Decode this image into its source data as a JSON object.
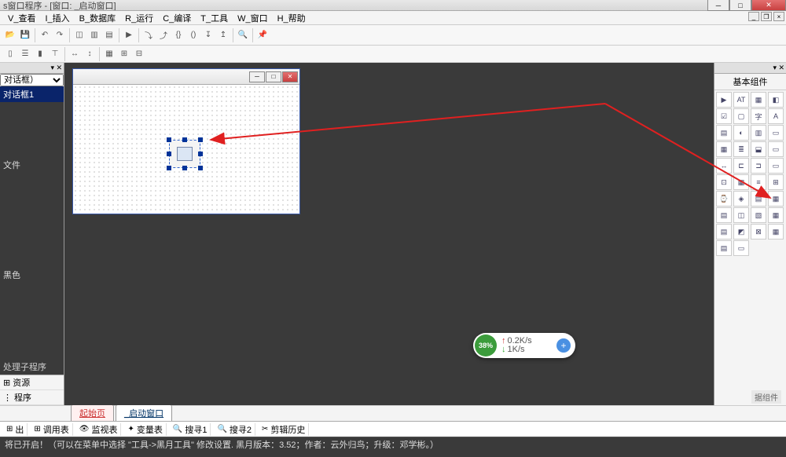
{
  "title": "s窗口程序 - [窗口: _启动窗口]",
  "menu": [
    "V_查看",
    "I_插入",
    "B_数据库",
    "R_运行",
    "C_编译",
    "T_工具",
    "W_窗口",
    "H_帮助"
  ],
  "left": {
    "combo": "对话框）",
    "selected": "对话框1",
    "items_mid": [
      "文件"
    ],
    "items_low": [
      "黑色"
    ],
    "proc": "处理子程序",
    "res": "⊞ 资源",
    "prog": "⋮ 程序"
  },
  "tabs": {
    "start": "起始页",
    "active": "_启动窗口"
  },
  "bottom_tabs": [
    "出",
    "调用表",
    "监视表",
    "变量表",
    "搜寻1",
    "搜寻2",
    "剪辑历史"
  ],
  "status": "将已开启！（可以在菜单中选择 \"工具->黑月工具\" 修改设置. 黑月版本：3.52；作者：云外归鸟；升级：邓学彬。）",
  "right": {
    "title": "基本组件",
    "bottom": "据组件"
  },
  "speed": {
    "pct": "38%",
    "up": "0.2K/s",
    "dn": "1K/s"
  },
  "palette_icons": [
    "▶",
    "AT",
    "▦",
    "◧",
    "☑",
    "▢",
    "字",
    "A",
    "▤",
    "◐",
    "▥",
    "▭",
    "▦",
    "≣",
    "⬓",
    "▭",
    "↔",
    "⊏",
    "⊐",
    "▭",
    "⊡",
    "▦",
    "≡",
    "⊞",
    "⌚",
    "◈",
    "▤",
    "▦",
    "▤",
    "◫",
    "▧",
    "▦",
    "▤",
    "◩",
    "⊠",
    "▦",
    "▤",
    "▭"
  ]
}
